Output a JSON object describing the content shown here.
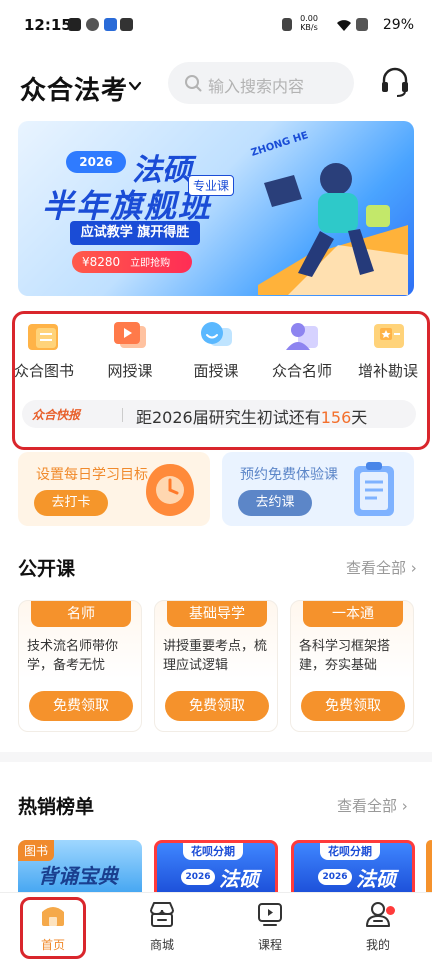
{
  "status_bar": {
    "time": "12:15",
    "battery": "29%",
    "net_speed": "0.00 KB/s"
  },
  "header": {
    "brand": "众合法考",
    "search_placeholder": "输入搜索内容"
  },
  "banner": {
    "year": "2026",
    "title1": "法硕",
    "title2": "半年旗舰班",
    "tag": "专业课",
    "slogan": "应试教学 旗开得胜",
    "price": "¥8280",
    "buy": "立即抢购",
    "logo": "ZHONG HE"
  },
  "quick_nav": [
    {
      "label": "众合图书",
      "icon": "book-icon"
    },
    {
      "label": "网授课",
      "icon": "video-play-icon"
    },
    {
      "label": "面授课",
      "icon": "chat-face-icon"
    },
    {
      "label": "众合名师",
      "icon": "teacher-icon"
    },
    {
      "label": "增补勘误",
      "icon": "star-card-icon"
    }
  ],
  "notice": {
    "tag": "众合快报",
    "text_before": "距2026届研究生初试还有",
    "days": "156",
    "text_after": "天"
  },
  "tasks": [
    {
      "title": "设置每日学习目标",
      "button": "去打卡",
      "icon": "clock-icon"
    },
    {
      "title": "预约免费体验课",
      "button": "去约课",
      "icon": "clipboard-icon"
    }
  ],
  "public_class": {
    "title": "公开课",
    "more": "查看全部 ›",
    "cards": [
      {
        "tag": "名师",
        "desc": "技术流名师带你学，备考无忧",
        "button": "免费领取"
      },
      {
        "tag": "基础导学",
        "desc": "讲授重要考点，梳理应试逻辑",
        "button": "免费领取"
      },
      {
        "tag": "一本通",
        "desc": "各科学习框架搭建，夯实基础",
        "button": "免费领取"
      }
    ]
  },
  "hot_list": {
    "title": "热销榜单",
    "more": "查看全部 ›",
    "items": [
      {
        "label": "图书",
        "title": "背诵宝典"
      },
      {
        "label": "花呗分期",
        "year": "2026",
        "title": "法硕"
      },
      {
        "label": "花呗分期",
        "year": "2026",
        "title": "法硕"
      }
    ]
  },
  "tabbar": [
    {
      "label": "首页",
      "icon": "home-icon",
      "active": true
    },
    {
      "label": "商城",
      "icon": "store-icon",
      "active": false
    },
    {
      "label": "课程",
      "icon": "course-play-icon",
      "active": false
    },
    {
      "label": "我的",
      "icon": "profile-icon",
      "active": false
    }
  ],
  "colors": {
    "accent": "#f5922c",
    "brand_blue": "#1a4cd6",
    "highlight_red": "#d9262c"
  }
}
